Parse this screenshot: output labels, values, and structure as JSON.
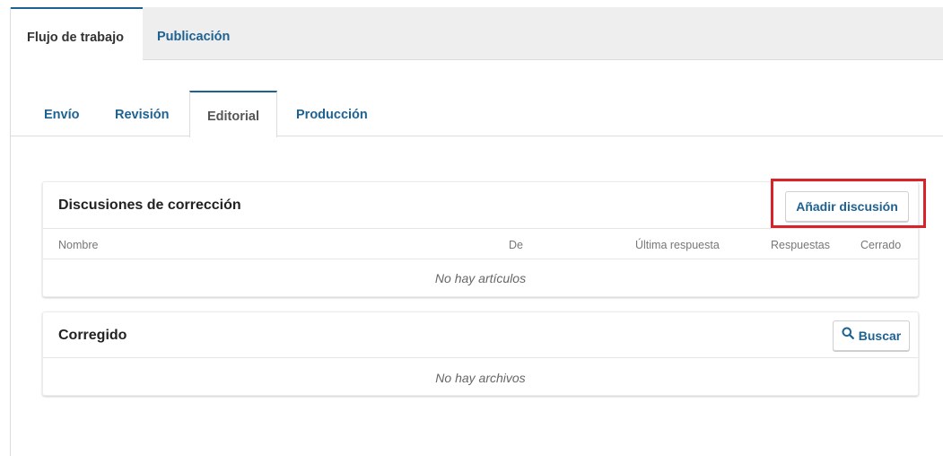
{
  "top_tabs": {
    "workflow": "Flujo de trabajo",
    "publication": "Publicación"
  },
  "sub_tabs": {
    "submission": "Envío",
    "review": "Revisión",
    "editorial": "Editorial",
    "production": "Producción"
  },
  "discussions": {
    "title": "Discusiones de corrección",
    "add_button": "Añadir discusión",
    "columns": [
      "Nombre",
      "De",
      "Última respuesta",
      "Respuestas",
      "Cerrado"
    ],
    "empty_text": "No hay artículos"
  },
  "corrected": {
    "title": "Corregido",
    "search_button": "Buscar",
    "empty_text": "No hay archivos"
  },
  "colors": {
    "accent": "#1e6292",
    "highlight": "#d8232a"
  }
}
